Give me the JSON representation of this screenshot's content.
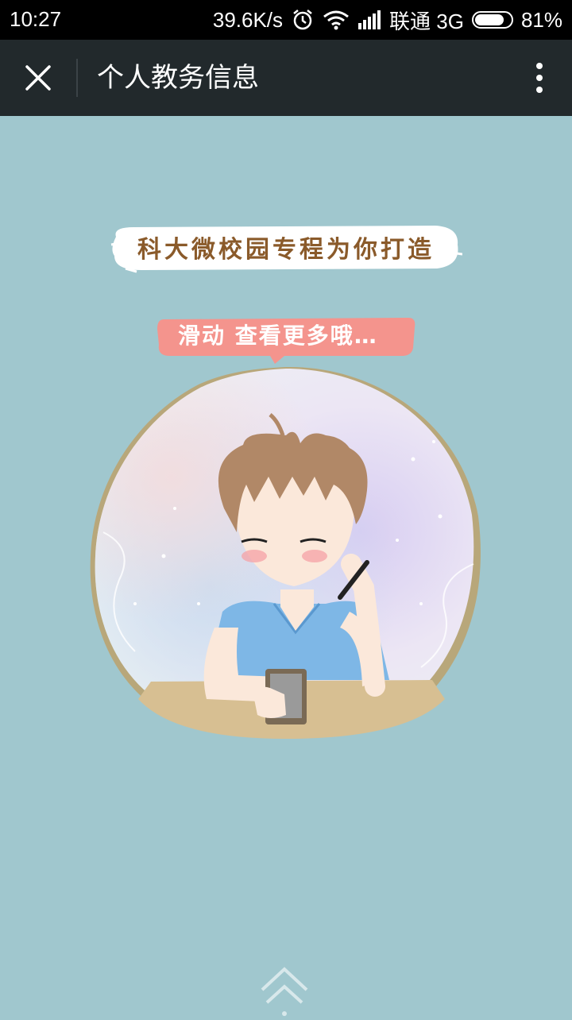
{
  "status_bar": {
    "time": "10:27",
    "network_speed": "39.6K/s",
    "carrier": "联通 3G",
    "battery_percent": "81%",
    "battery_level": 0.81,
    "icons": [
      "alarm-icon",
      "wifi-icon",
      "signal-icon",
      "battery-icon"
    ]
  },
  "title_bar": {
    "title": "个人教务信息",
    "icons": [
      "close-icon",
      "more-vertical-icon"
    ]
  },
  "content": {
    "banner_text": "科大微校园专程为你打造",
    "hint_text": "滑动 查看更多哦…",
    "swipe_icon": "double-chevron-up-icon"
  },
  "colors": {
    "background": "#a0c7ce",
    "title_bar": "#22292c",
    "hint_bubble": "#f4948d",
    "banner_text": "#8a5a2a"
  }
}
